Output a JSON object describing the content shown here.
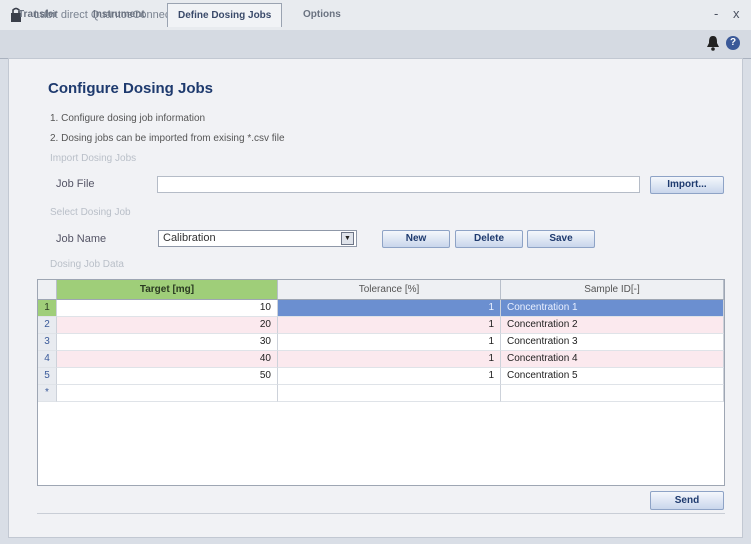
{
  "window": {
    "title": "Labit direct QuantosConnect",
    "minimize": "-",
    "close": "x"
  },
  "tabs": [
    {
      "label": "Transfer"
    },
    {
      "label": "Instrument"
    },
    {
      "label": "Define Dosing Jobs"
    },
    {
      "label": "Options"
    }
  ],
  "help": "?",
  "page": {
    "heading": "Configure Dosing Jobs",
    "steps": [
      "1. Configure dosing job information",
      "2. Dosing jobs can be imported from exising *.csv file"
    ],
    "import_section": "Import Dosing Jobs",
    "job_file_label": "Job File",
    "job_file_value": "",
    "import_button": "Import...",
    "select_section": "Select Dosing Job",
    "job_name_label": "Job Name",
    "job_name_value": "Calibration",
    "new_button": "New",
    "delete_button": "Delete",
    "save_button": "Save",
    "data_section": "Dosing Job Data",
    "send_button": "Send"
  },
  "table": {
    "columns": [
      "Target [mg]",
      "Tolerance [%]",
      "Sample ID[-]"
    ],
    "rows": [
      {
        "num": "1",
        "target": "10",
        "tolerance": "1",
        "sample": "Concentration 1"
      },
      {
        "num": "2",
        "target": "20",
        "tolerance": "1",
        "sample": "Concentration 2"
      },
      {
        "num": "3",
        "target": "30",
        "tolerance": "1",
        "sample": "Concentration 3"
      },
      {
        "num": "4",
        "target": "40",
        "tolerance": "1",
        "sample": "Concentration 4"
      },
      {
        "num": "5",
        "target": "50",
        "tolerance": "1",
        "sample": "Concentration 5"
      }
    ],
    "new_row_marker": "*"
  },
  "colors": {
    "accent": "#1e3a6e",
    "header_green": "#9fce79",
    "selection": "#6b8fd0",
    "alt_row": "#fbe9ee"
  }
}
